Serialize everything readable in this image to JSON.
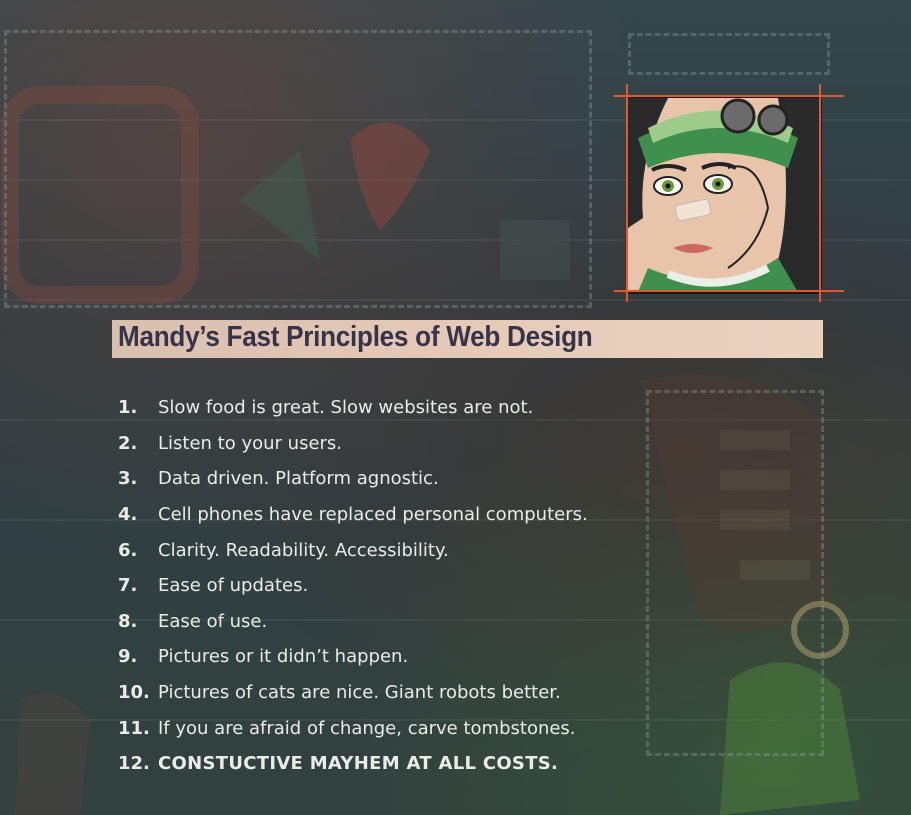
{
  "title": "Mandy’s Fast Principles of Web Design",
  "principles": [
    {
      "num": "1.",
      "text": "Slow food is great. Slow websites are not."
    },
    {
      "num": "2.",
      "text": "Listen to your users."
    },
    {
      "num": "3.",
      "text": "Data driven. Platform agnostic."
    },
    {
      "num": "4.",
      "text": "Cell phones have replaced personal computers."
    },
    {
      "num": "6.",
      "text": "Clarity. Readability. Accessibility."
    },
    {
      "num": "7.",
      "text": "Ease of updates."
    },
    {
      "num": "8.",
      "text": "Ease of use."
    },
    {
      "num": "9.",
      "text": "Pictures or it didn’t happen."
    },
    {
      "num": "10.",
      "text": "Pictures of cats are nice. Giant robots better."
    },
    {
      "num": "11.",
      "text": "If you are afraid of change, carve tombstones."
    },
    {
      "num": "12.",
      "text": "CONSTUCTIVE MAYHEM AT ALL COSTS."
    }
  ],
  "colors": {
    "title_bar": "#e6cbb9",
    "title_text": "#37344a",
    "crop_marks": "#e2582c",
    "list_text": "#e9ece8"
  },
  "icons": {
    "portrait": "comic-woman-portrait-icon"
  }
}
